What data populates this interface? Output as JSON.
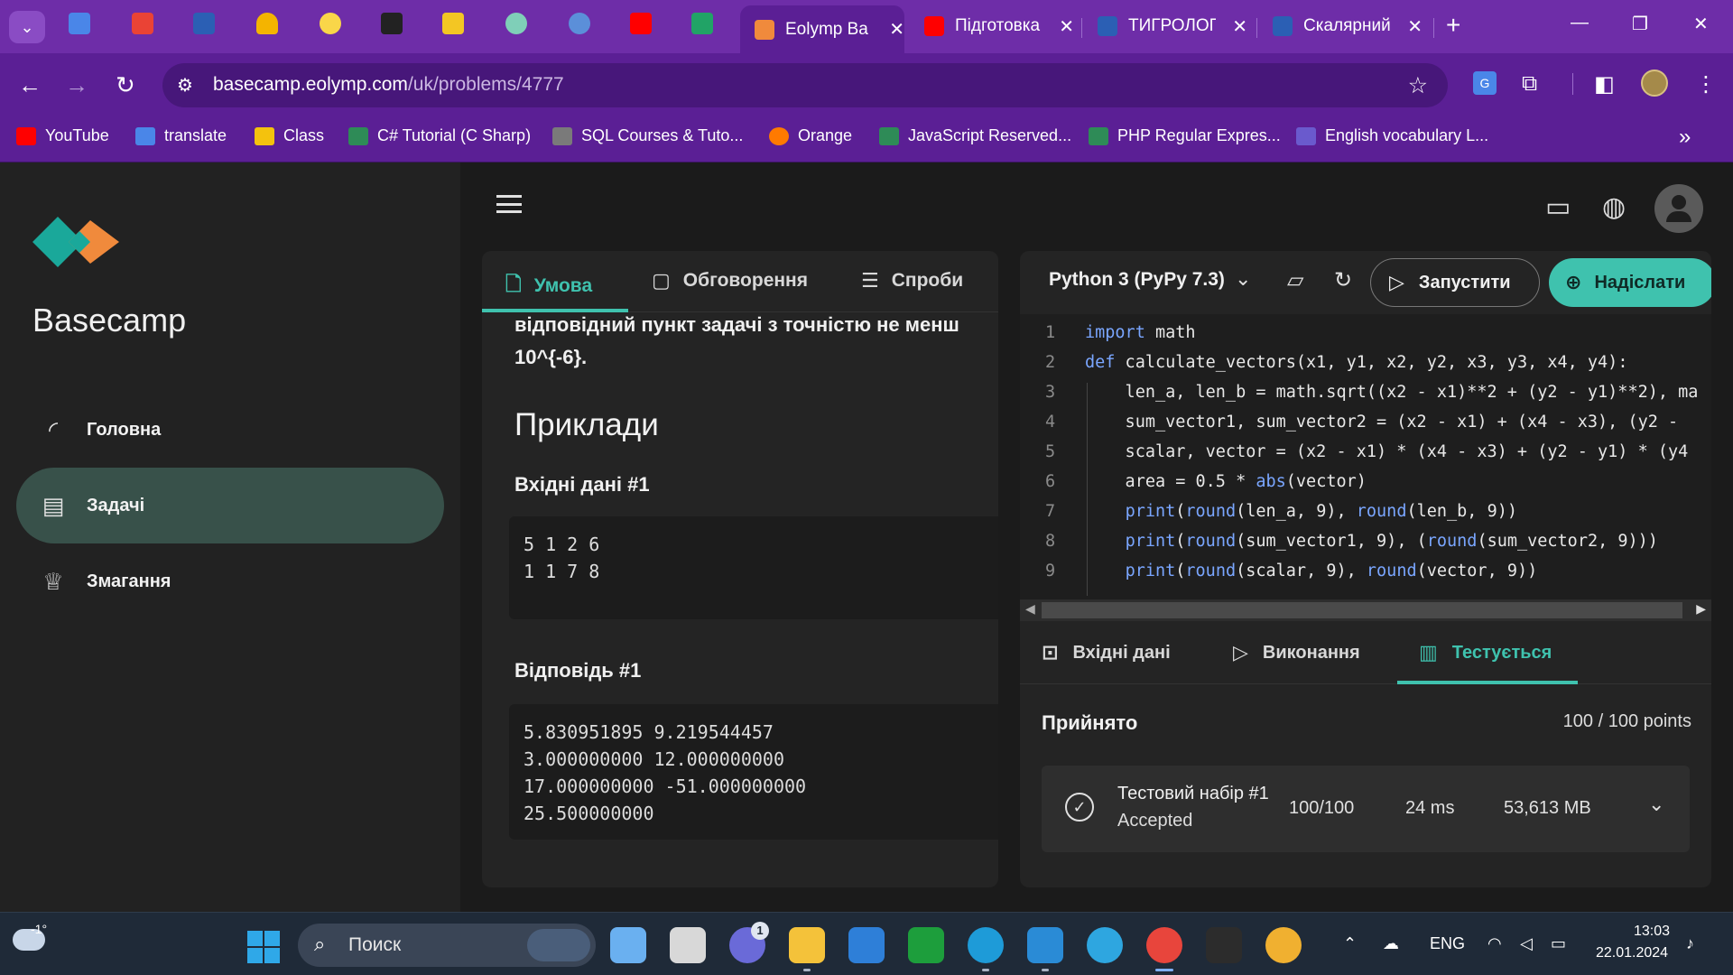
{
  "browser": {
    "tabs": [
      {
        "title": "Eolymp Ba",
        "active": true
      },
      {
        "title": "Підготовка",
        "active": false
      },
      {
        "title": "ТИГРОЛОГ",
        "active": false
      },
      {
        "title": "Скалярний",
        "active": false
      }
    ],
    "new_tab": "+",
    "window_controls": {
      "minimize": "—",
      "restore": "❐",
      "close": "✕"
    },
    "url_host": "basecamp.eolymp.com",
    "url_path": "/uk/problems/4777",
    "bookmarks": [
      {
        "label": "YouTube",
        "color": "#ff0000"
      },
      {
        "label": "translate",
        "color": "#4a86e8"
      },
      {
        "label": "Class",
        "color": "#f4c20d"
      },
      {
        "label": "C# Tutorial (C Sharp)",
        "color": "#2e8b57"
      },
      {
        "label": "SQL Courses & Tuto...",
        "color": "#7a7a7a"
      },
      {
        "label": "Orange",
        "color": "#ff7a00"
      },
      {
        "label": "JavaScript Reserved...",
        "color": "#2e8b57"
      },
      {
        "label": "PHP Regular Expres...",
        "color": "#2e8b57"
      },
      {
        "label": "English vocabulary L...",
        "color": "#6a5acd"
      }
    ],
    "bookmarks_more": "»"
  },
  "sidebar": {
    "brand": "Basecamp",
    "items": [
      {
        "label": "Головна",
        "icon": "rss-icon",
        "active": false
      },
      {
        "label": "Задачі",
        "icon": "clipboard-icon",
        "active": true
      },
      {
        "label": "Змагання",
        "icon": "trophy-icon",
        "active": false
      }
    ]
  },
  "problem": {
    "tabs": [
      {
        "label": "Умова",
        "icon": "document-icon",
        "active": true
      },
      {
        "label": "Обговорення",
        "icon": "chat-icon",
        "active": false
      },
      {
        "label": "Спроби",
        "icon": "list-icon",
        "active": false
      }
    ],
    "statement_line1": "відповідний пункт задачі з точністю не менш",
    "statement_line2": "10^{-6}.",
    "examples_title": "Приклади",
    "input_label": "Вхідні дані #1",
    "input_lines": [
      "5 1 2 6",
      "1 1 7 8"
    ],
    "output_label": "Відповідь #1",
    "output_lines": [
      "5.830951895 9.219544457",
      "3.000000000 12.000000000",
      "17.000000000 -51.000000000",
      "25.500000000"
    ]
  },
  "editor": {
    "language": "Python 3 (PyPy 7.3)",
    "run_label": "Запустити",
    "submit_label": "Надіслати",
    "lines": [
      {
        "n": "1",
        "text": "import math"
      },
      {
        "n": "2",
        "text": "def calculate_vectors(x1, y1, x2, y2, x3, y3, x4, y4):"
      },
      {
        "n": "3",
        "text": "    len_a, len_b = math.sqrt((x2 - x1)**2 + (y2 - y1)**2), ma"
      },
      {
        "n": "4",
        "text": "    sum_vector1, sum_vector2 = (x2 - x1) + (x4 - x3), (y2 -"
      },
      {
        "n": "5",
        "text": "    scalar, vector = (x2 - x1) * (x4 - x3) + (y2 - y1) * (y4"
      },
      {
        "n": "6",
        "text": "    area = 0.5 * abs(vector)"
      },
      {
        "n": "7",
        "text": "    print(round(len_a, 9), round(len_b, 9))"
      },
      {
        "n": "8",
        "text": "    print(round(sum_vector1, 9), (round(sum_vector2, 9)))"
      },
      {
        "n": "9",
        "text": "    print(round(scalar, 9), round(vector, 9))"
      }
    ],
    "bottom_tabs": [
      {
        "label": "Вхідні дані",
        "icon": "terminal-icon",
        "active": false
      },
      {
        "label": "Виконання",
        "icon": "play-icon",
        "active": false
      },
      {
        "label": "Тестується",
        "icon": "chart-icon",
        "active": true
      }
    ],
    "result": {
      "status": "Прийнято",
      "points": "100 / 100 points",
      "test_name": "Тестовий набір #1",
      "test_status": "Accepted",
      "score": "100/100",
      "time": "24 ms",
      "memory": "53,613 MB"
    }
  },
  "taskbar": {
    "weather": "-1°",
    "search_placeholder": "Поиск",
    "chat_badge": "1",
    "language": "ENG",
    "time": "13:03",
    "date": "22.01.2024"
  }
}
